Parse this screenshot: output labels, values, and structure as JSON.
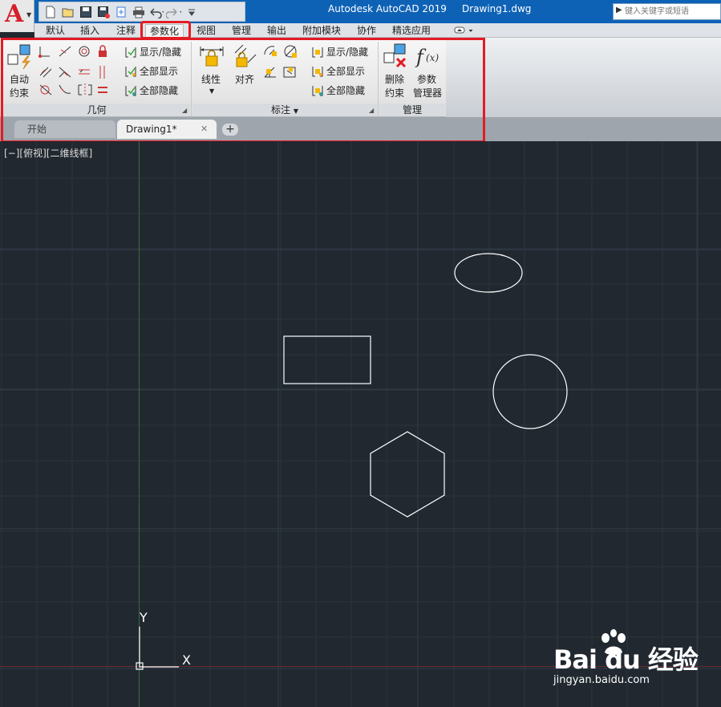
{
  "window": {
    "title": "Autodesk AutoCAD 2019",
    "file": "Drawing1.dwg"
  },
  "app_button": {
    "letter": "A",
    "icon": "autocad-logo-icon"
  },
  "quick_access": [
    {
      "icon": "new-icon"
    },
    {
      "icon": "open-icon"
    },
    {
      "icon": "save-icon"
    },
    {
      "icon": "save-as-icon"
    },
    {
      "icon": "export-icon"
    },
    {
      "icon": "plot-icon"
    },
    {
      "icon": "undo-icon"
    },
    {
      "icon": "redo-icon"
    },
    {
      "icon": "customize-icon"
    }
  ],
  "search": {
    "placeholder": "键入关键字或短语"
  },
  "ribbon_tabs": [
    {
      "label": "默认",
      "active": false
    },
    {
      "label": "插入",
      "active": false
    },
    {
      "label": "注释",
      "active": false
    },
    {
      "label": "参数化",
      "active": true
    },
    {
      "label": "视图",
      "active": false
    },
    {
      "label": "管理",
      "active": false
    },
    {
      "label": "输出",
      "active": false
    },
    {
      "label": "附加模块",
      "active": false
    },
    {
      "label": "协作",
      "active": false
    },
    {
      "label": "精选应用",
      "active": false
    }
  ],
  "panels": {
    "geometry": {
      "title": "几何",
      "auto_constrain": "自动\n约束",
      "auto_constrain_l1": "自动",
      "auto_constrain_l2": "约束",
      "show_hide": "显示/隐藏",
      "show_all": "全部显示",
      "hide_all": "全部隐藏"
    },
    "dimensional": {
      "title": "标注",
      "linear": "线性",
      "aligned": "对齐",
      "show_hide": "显示/隐藏",
      "show_all": "全部显示",
      "hide_all": "全部隐藏"
    },
    "manage": {
      "title": "管理",
      "delete_l1": "删除",
      "delete_l2": "约束",
      "params_l1": "参数",
      "params_l2": "管理器"
    }
  },
  "file_tabs": {
    "start": "开始",
    "drawing": "Drawing1*",
    "close": "✕",
    "add": "+"
  },
  "viewport": {
    "label": "[−][俯视][二维线框]"
  },
  "ucs": {
    "y_label": "Y",
    "x_label": "X"
  },
  "watermark": {
    "brand": "Bai du 经验",
    "url": "jingyan.baidu.com"
  },
  "colors": {
    "titlebar": "#0e62b6",
    "canvas_bg": "#212830",
    "highlight": "#e31b23",
    "shape_stroke": "#ffffff"
  }
}
